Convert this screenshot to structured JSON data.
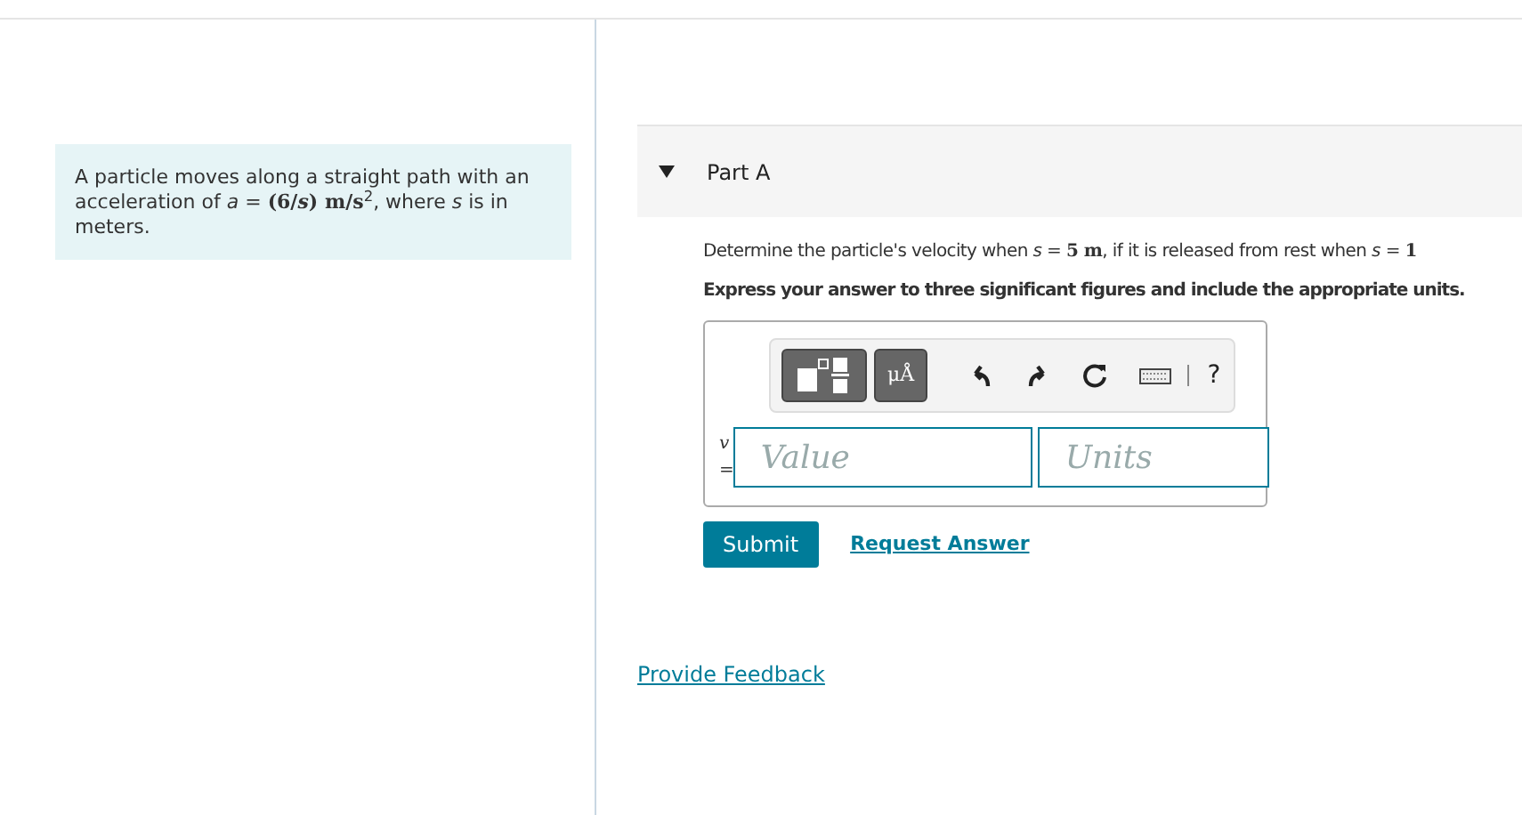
{
  "problem": {
    "text": "A particle moves along a straight path with an acceleration of *a* = **(6/*s*)  m/s**$^{2}$, where *s* is in meters."
  },
  "part": {
    "expanded": true,
    "title": "Part A",
    "question": "Determine the particle's velocity when *s* = **5 m**, if it is released from rest when *s* = **1**",
    "instruction": "Express your answer to three significant figures and include the appropriate units.",
    "answer": {
      "variable": "v",
      "equals": "=",
      "value_placeholder": "Value",
      "units_placeholder": "Units",
      "toolbar": [
        {
          "kind": "templates"
        },
        {
          "kind": "units",
          "label": "μÅ"
        },
        {
          "kind": "undo"
        },
        {
          "kind": "redo"
        },
        {
          "kind": "reset"
        },
        {
          "kind": "keyboard"
        },
        {
          "kind": "help",
          "label": "?"
        }
      ]
    },
    "submit": "Submit",
    "request": "Request Answer"
  },
  "feedback": "Provide Feedback"
}
